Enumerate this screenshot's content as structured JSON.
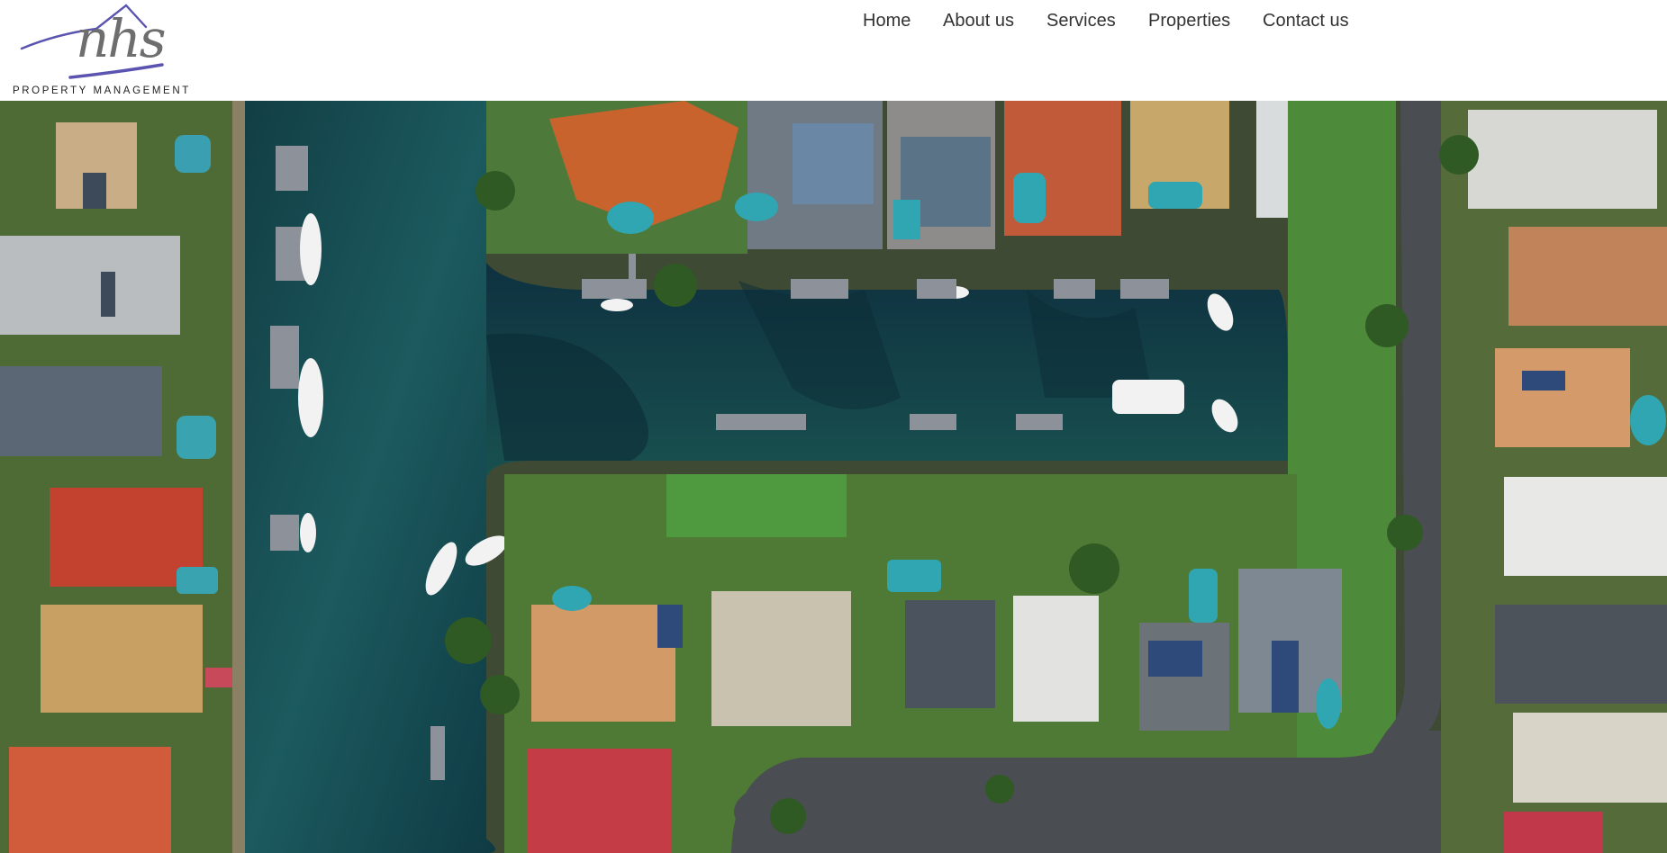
{
  "logo": {
    "mark": "nhs",
    "subtitle": "PROPERTY MANAGEMENT",
    "accent_color": "#5a54b0",
    "mark_color": "#6e6e6e"
  },
  "nav": {
    "items": [
      {
        "label": "Home"
      },
      {
        "label": "About us"
      },
      {
        "label": "Services"
      },
      {
        "label": "Properties"
      },
      {
        "label": "Contact us"
      }
    ]
  },
  "hero": {
    "image": "aerial-photo-canal-waterfront-houses"
  }
}
